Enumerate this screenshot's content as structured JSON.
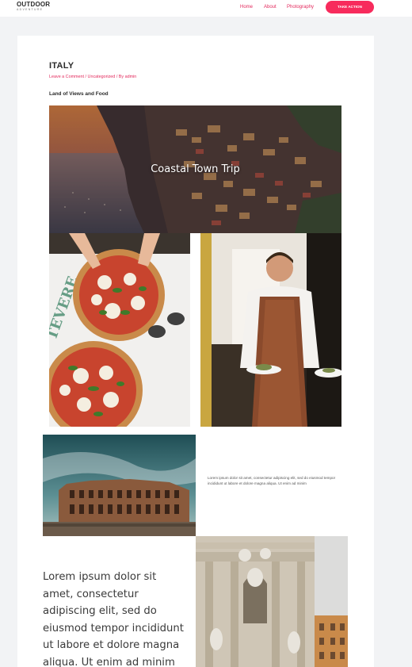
{
  "header": {
    "logo_top": "OUTDOOR",
    "logo_bottom": "ADVENTURE",
    "nav": [
      {
        "label": "Home"
      },
      {
        "label": "About"
      },
      {
        "label": "Photography"
      }
    ],
    "cta_label": "TAKE ACTION"
  },
  "post": {
    "title": "ITALY",
    "meta": {
      "comment_link": "Leave a Comment",
      "separator": "/",
      "category": "Uncategorized",
      "by": "/ By",
      "author": "admin"
    },
    "subtitle": "Land of Views and Food",
    "hero_caption": "Coastal Town Trip",
    "small_paragraph": "Lorem ipsum dolor sit amet, consectetur adipiscing elit, sed do eiusmod tempor incididunt ut labore et dolore magna aliqua. Ut enim ad minim",
    "large_paragraph": "Lorem ipsum dolor sit amet, consectetur adipiscing elit, sed do eiusmod tempor incididunt ut labore et dolore magna aliqua. Ut enim ad minim"
  },
  "colors": {
    "accent": "#e32a5d",
    "cta_background": "#f72b5c",
    "page_background": "#f2f3f5"
  }
}
